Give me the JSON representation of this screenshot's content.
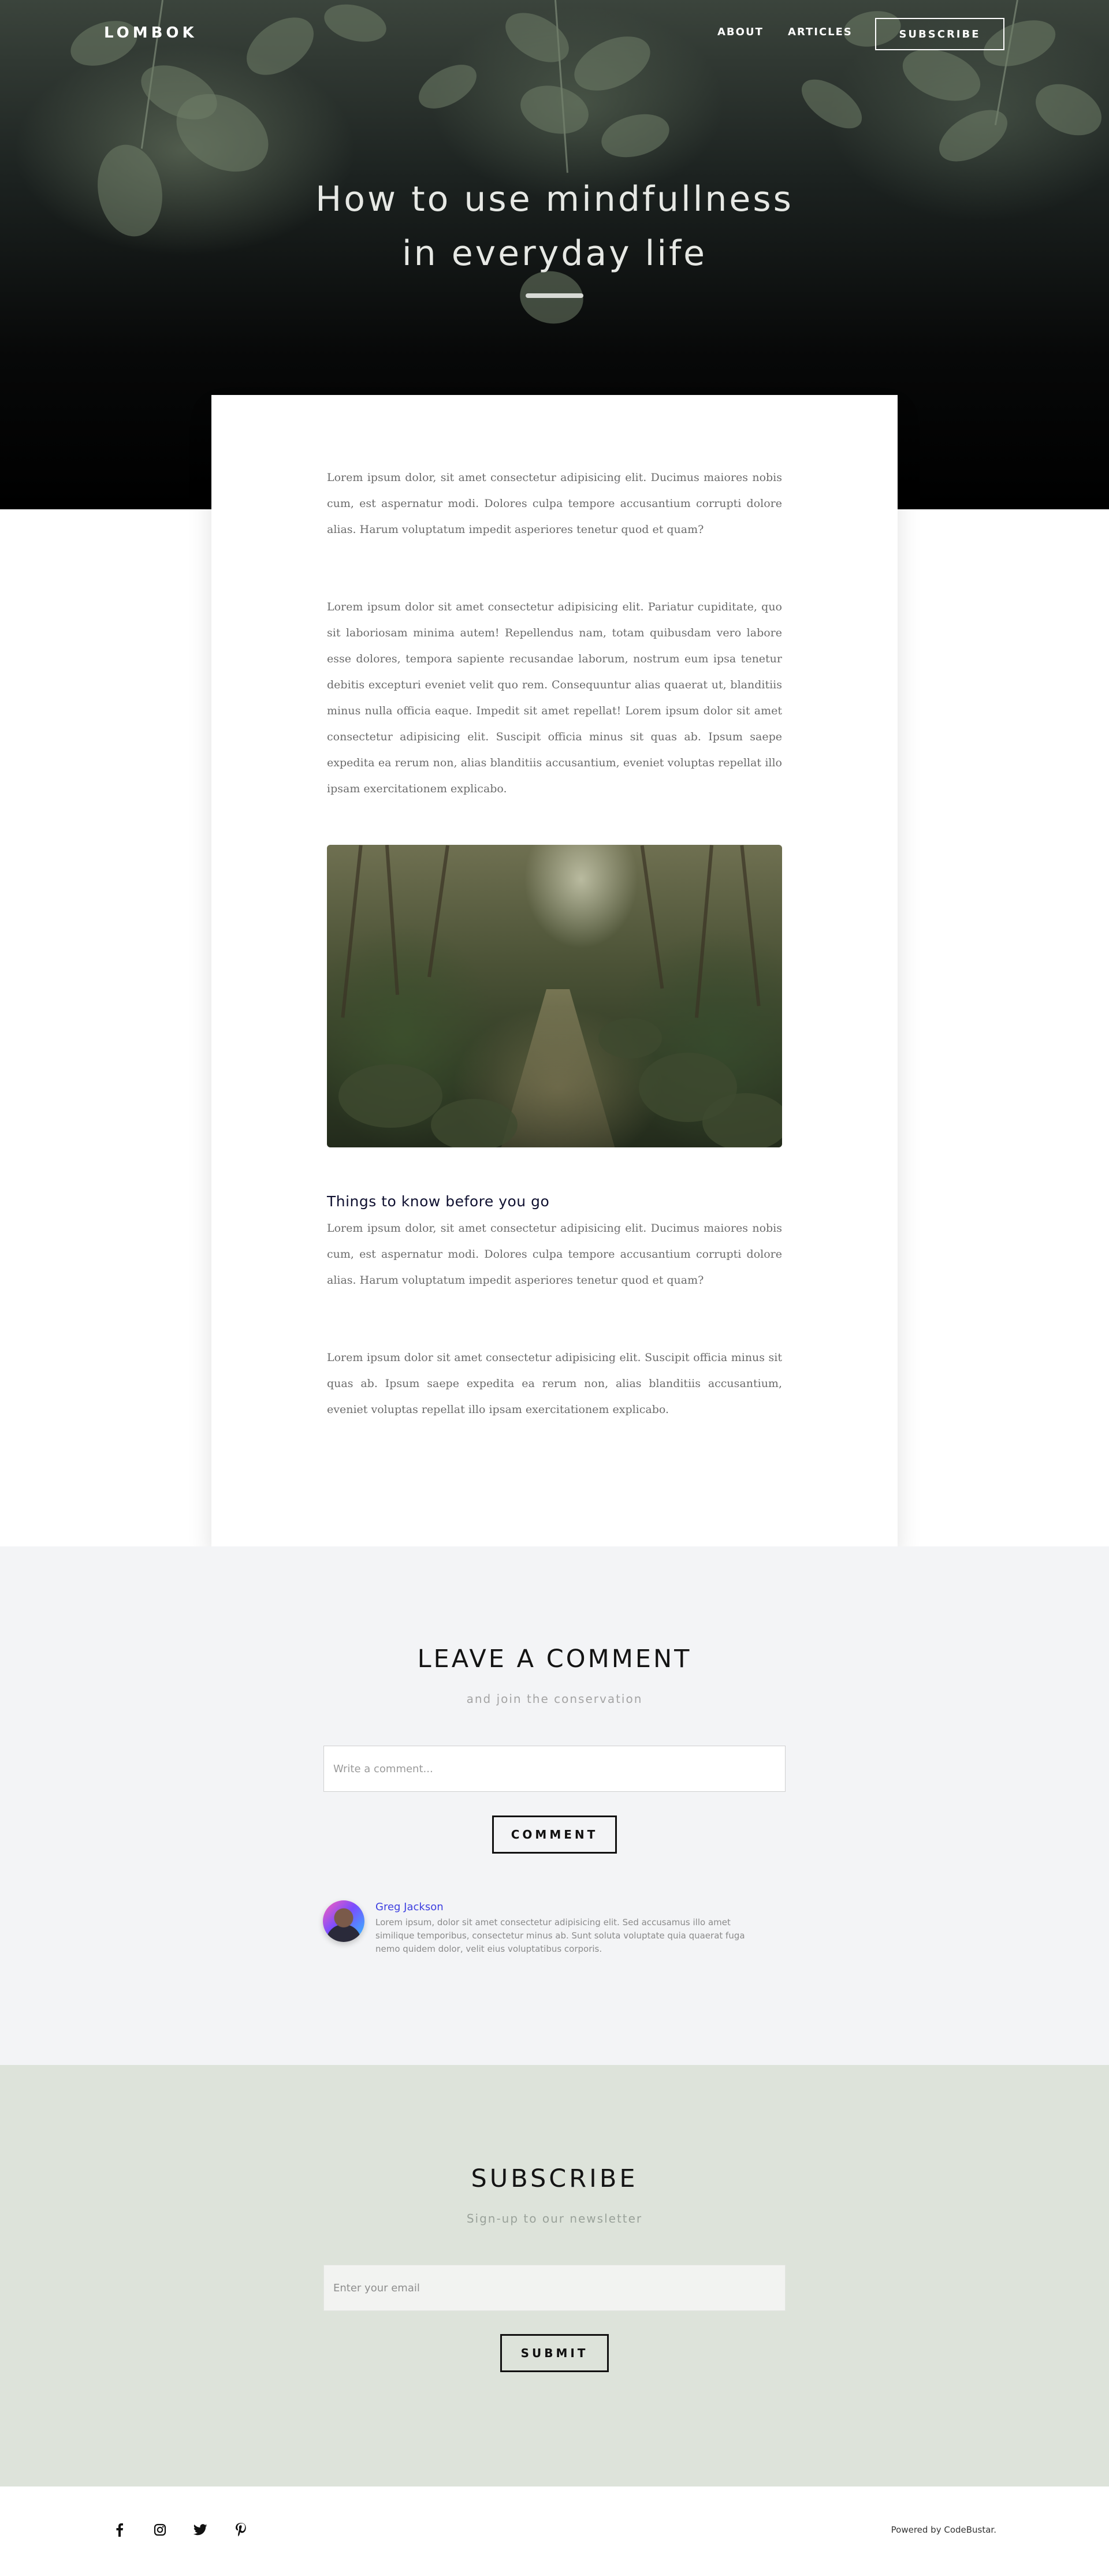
{
  "nav": {
    "logo": "LOMBOK",
    "about": "ABOUT",
    "articles": "ARTICLES",
    "subscribe": "SUBSCRIBE"
  },
  "hero": {
    "title_line1": "How to use mindfullness",
    "title_line2": "in everyday life"
  },
  "article": {
    "paragraph1": "Lorem ipsum dolor, sit amet consectetur adipisicing elit. Ducimus maiores nobis cum, est aspernatur modi. Dolores culpa tempore accusantium corrupti dolore alias. Harum voluptatum impedit asperiores tenetur quod et quam?",
    "paragraph2": "Lorem ipsum dolor sit amet consectetur adipisicing elit. Pariatur cupiditate, quo sit laboriosam minima autem! Repellendus nam, totam quibusdam vero labore esse dolores, tempora sapiente recusandae laborum, nostrum eum ipsa tenetur debitis excepturi eveniet velit quo rem. Consequuntur alias quaerat ut, blanditiis minus nulla officia eaque. Impedit sit amet repellat! Lorem ipsum dolor sit amet consectetur adipisicing elit. Suscipit officia minus sit quas ab. Ipsum saepe expedita ea rerum non, alias blanditiis accusantium, eveniet voluptas repellat illo ipsam exercitationem explicabo.",
    "section_heading": "Things to know before you go",
    "paragraph3": "Lorem ipsum dolor, sit amet consectetur adipisicing elit. Ducimus maiores nobis cum, est aspernatur modi. Dolores culpa tempore accusantium corrupti dolore alias. Harum voluptatum impedit asperiores tenetur quod et quam?",
    "paragraph4": "Lorem ipsum dolor sit amet consectetur adipisicing elit. Suscipit officia minus sit quas ab. Ipsum saepe expedita ea rerum non, alias blanditiis accusantium, eveniet voluptas repellat illo ipsam exercitationem explicabo."
  },
  "comments": {
    "title": "LEAVE A COMMENT",
    "subtitle": "and join the conservation",
    "input_placeholder": "Write a comment...",
    "button": "COMMENT",
    "items": [
      {
        "author": "Greg Jackson",
        "text": "Lorem ipsum, dolor sit amet consectetur adipisicing elit. Sed accusamus illo amet similique temporibus, consectetur minus ab. Sunt soluta voluptate quia quaerat fuga nemo quidem dolor, velit eius voluptatibus corporis."
      }
    ]
  },
  "subscribe": {
    "title": "SUBSCRIBE",
    "subtitle": "Sign-up to our newsletter",
    "input_placeholder": "Enter your email",
    "button": "SUBMIT"
  },
  "footer": {
    "social_icons": [
      "facebook-icon",
      "instagram-icon",
      "twitter-icon",
      "pinterest-icon"
    ],
    "powered_by": "Powered by CodeBustar."
  }
}
